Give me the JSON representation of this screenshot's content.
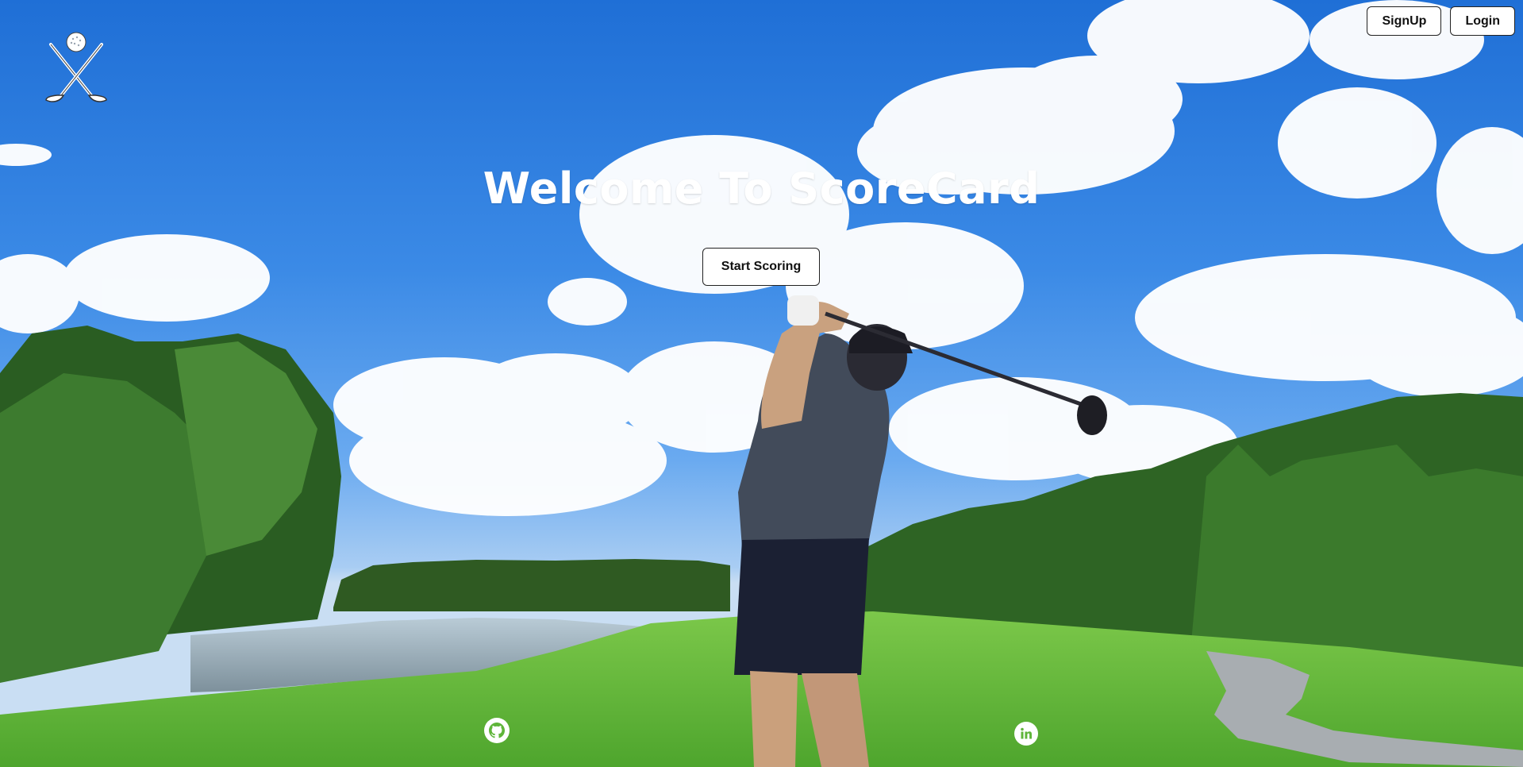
{
  "app": {
    "title": "Welcome To ScoreCard"
  },
  "header": {
    "logo_icon": "crossed-golf-clubs-with-ball-icon",
    "signup_label": "SignUp",
    "login_label": "Login"
  },
  "hero": {
    "heading": "Welcome To ScoreCard",
    "cta_label": "Start Scoring",
    "background": "golfer-teeing-off-on-fairway-photo"
  },
  "footer": {
    "links": [
      {
        "icon": "github-icon"
      },
      {
        "icon": "linkedin-icon"
      }
    ]
  },
  "colors": {
    "button_bg": "#ffffff",
    "button_border": "#222222",
    "heading_text": "#ffffff",
    "sky": "#2f7fe0",
    "grass": "#5fb53a"
  }
}
